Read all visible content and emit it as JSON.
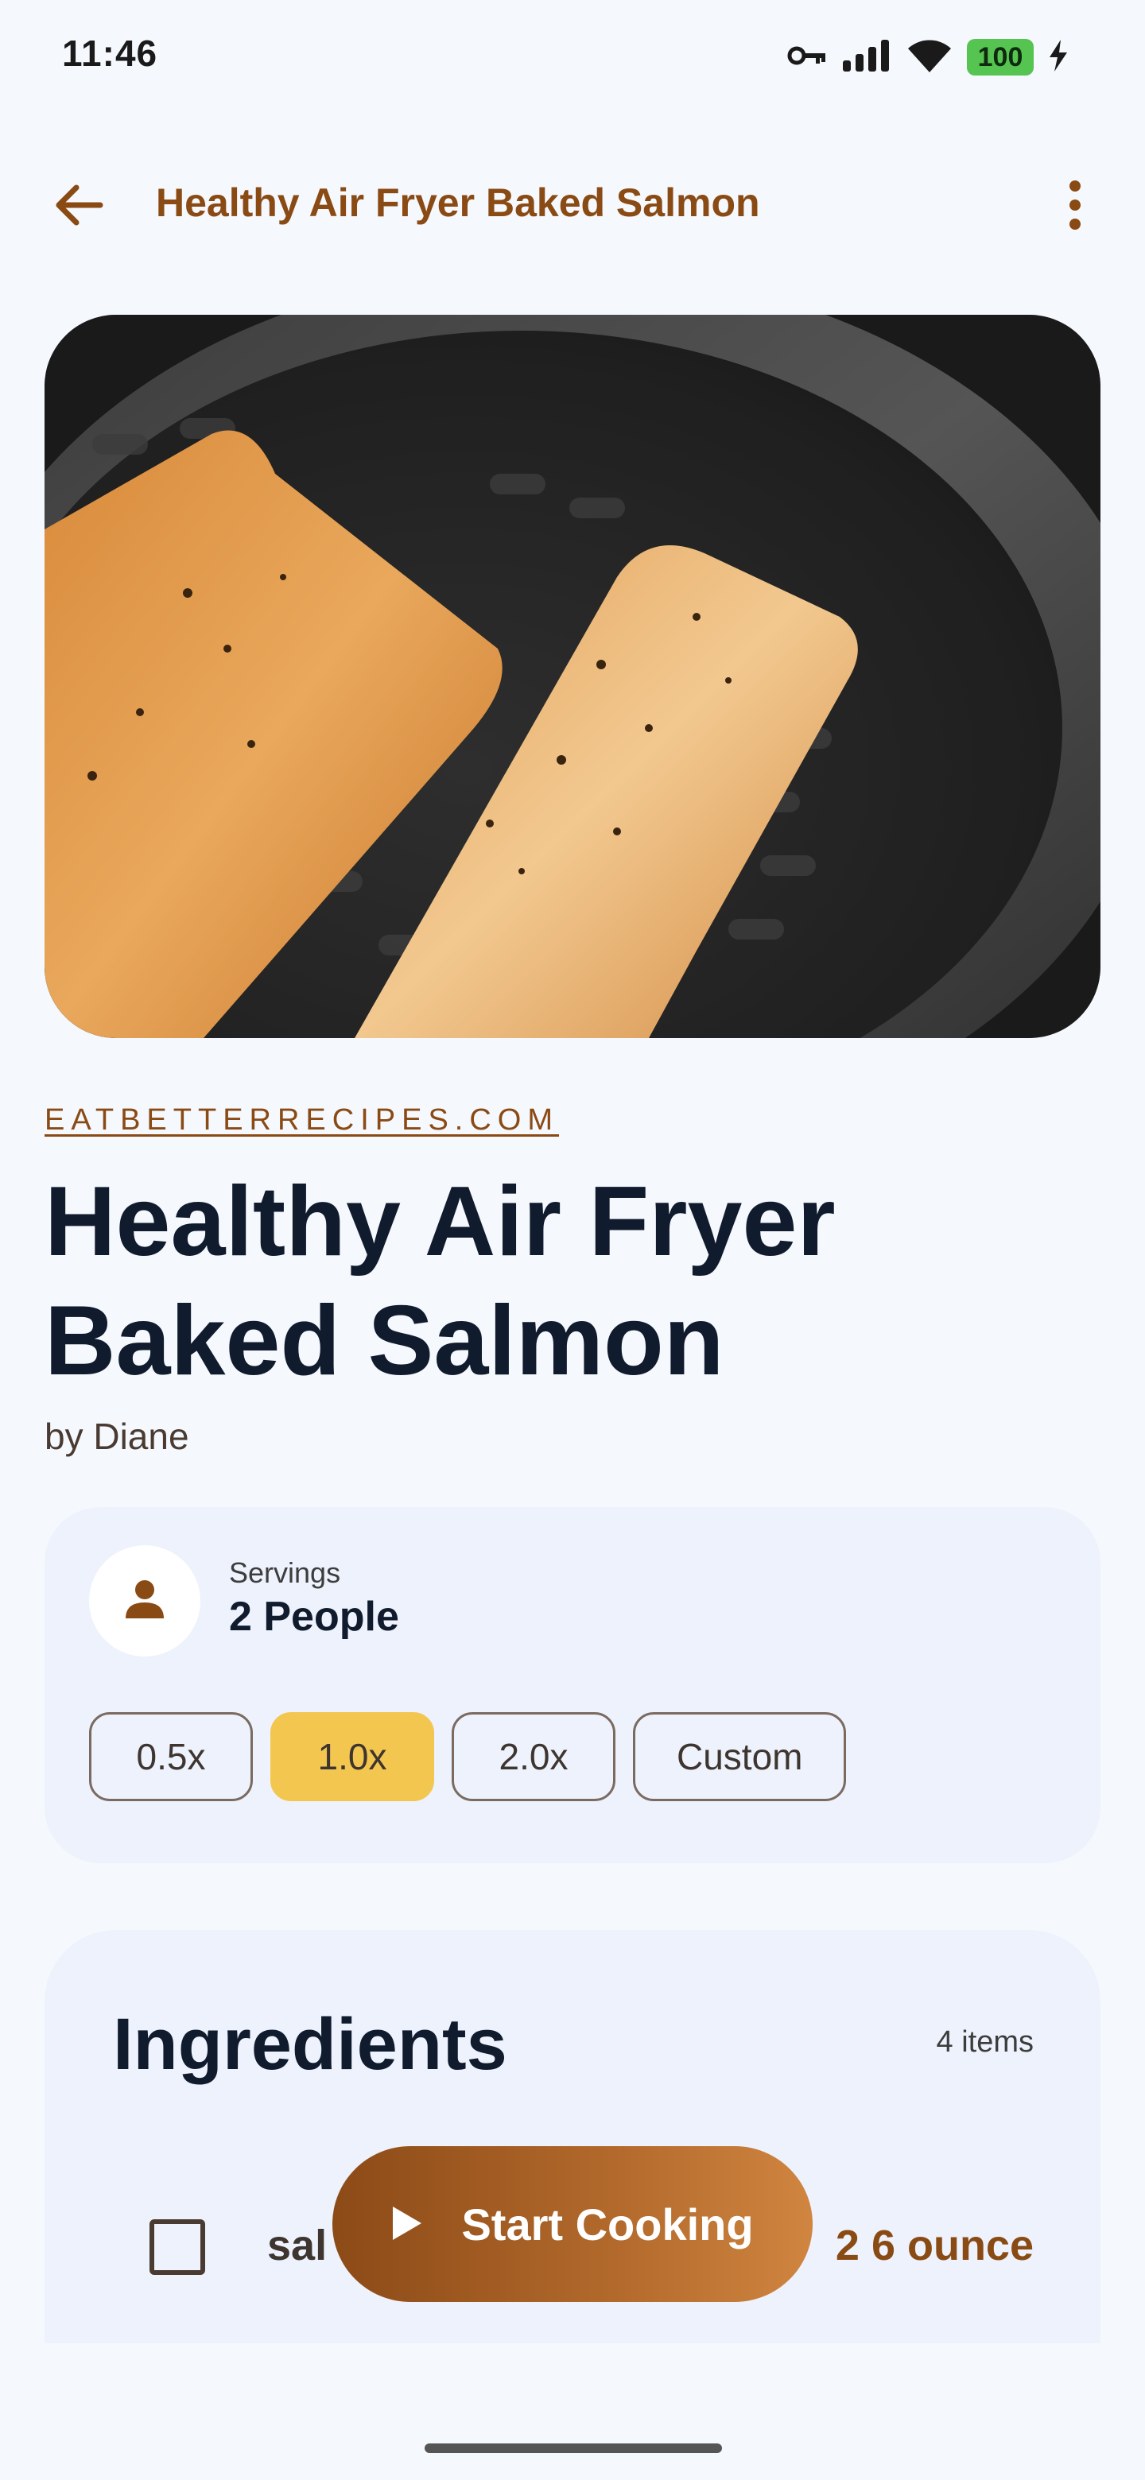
{
  "status_bar": {
    "time": "11:46",
    "battery_level": "100",
    "icons": [
      "vpn-key-icon",
      "signal-icon",
      "wifi-icon",
      "battery-icon",
      "charging-bolt-icon"
    ]
  },
  "app_bar": {
    "title": "Healthy Air Fryer Baked Salmon",
    "back_icon": "arrow-back-icon",
    "menu_icon": "more-vert-icon"
  },
  "recipe": {
    "source": "EATBETTERRECIPES.COM",
    "title": "Healthy Air Fryer Baked Salmon",
    "author": "by Diane",
    "image": "salmon-fillets-in-air-fryer-basket"
  },
  "servings": {
    "label": "Servings",
    "value": "2 People",
    "icon": "person-icon",
    "multipliers": [
      {
        "label": "0.5x",
        "selected": false
      },
      {
        "label": "1.0x",
        "selected": true
      },
      {
        "label": "2.0x",
        "selected": false
      },
      {
        "label": "Custom",
        "selected": false
      }
    ]
  },
  "ingredients": {
    "title": "Ingredients",
    "count": "4 items",
    "items": [
      {
        "name": "sal",
        "quantity": "2 6 ounce",
        "checked": false
      }
    ]
  },
  "fab": {
    "label": "Start Cooking",
    "icon": "play-icon"
  },
  "colors": {
    "accent": "#8A4A14",
    "selected_chip": "#F3C64F",
    "background": "#F5F8FD",
    "card": "#EDF2FC",
    "title_text": "#101B2D"
  }
}
